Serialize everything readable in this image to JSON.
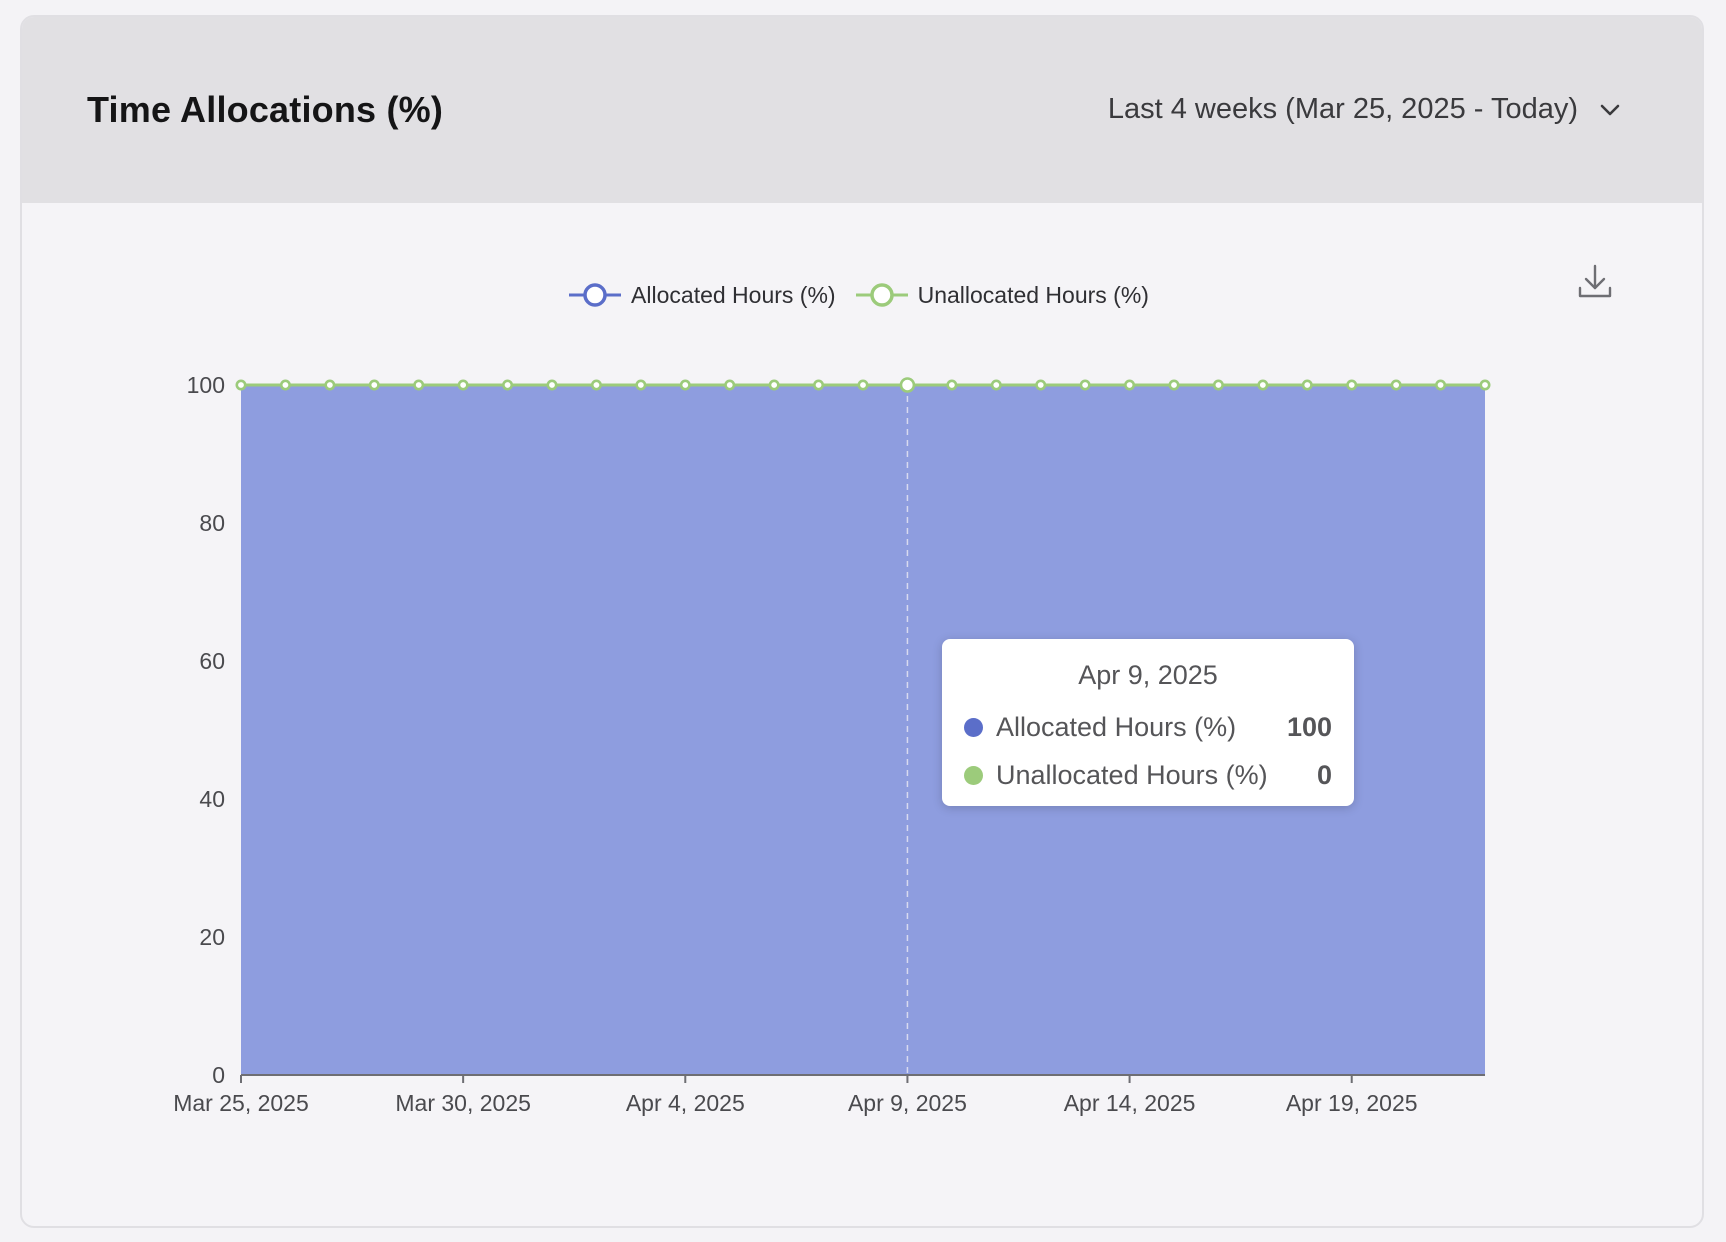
{
  "header": {
    "title": "Time Allocations (%)",
    "range_label": "Last 4 weeks (Mar 25, 2025 - Today)"
  },
  "icons": {
    "range_dropdown": "chevron-down-icon",
    "download": "download-icon"
  },
  "colors": {
    "allocated": "#5b6ec9",
    "allocated_area": "#8e9ddf",
    "unallocated": "#9ccb7b",
    "grid": "#9da9e0",
    "axis": "#6e6e73",
    "tick_text": "#4a4a4e"
  },
  "tooltip": {
    "date": "Apr 9, 2025",
    "rows": [
      {
        "name": "Allocated Hours (%)",
        "value": "100"
      },
      {
        "name": "Unallocated Hours (%)",
        "value": "0"
      }
    ]
  },
  "chart_data": {
    "type": "area",
    "title": "Time Allocations (%)",
    "xlabel": "",
    "ylabel": "",
    "ylim": [
      0,
      100
    ],
    "yticks": [
      "0",
      "20",
      "40",
      "60",
      "80",
      "100"
    ],
    "xticks": [
      "Mar 25, 2025",
      "Mar 30, 2025",
      "Apr 4, 2025",
      "Apr 9, 2025",
      "Apr 14, 2025",
      "Apr 19, 2025"
    ],
    "x": [
      "2025-03-25",
      "2025-03-26",
      "2025-03-27",
      "2025-03-28",
      "2025-03-29",
      "2025-03-30",
      "2025-03-31",
      "2025-04-01",
      "2025-04-02",
      "2025-04-03",
      "2025-04-04",
      "2025-04-05",
      "2025-04-06",
      "2025-04-07",
      "2025-04-08",
      "2025-04-09",
      "2025-04-10",
      "2025-04-11",
      "2025-04-12",
      "2025-04-13",
      "2025-04-14",
      "2025-04-15",
      "2025-04-16",
      "2025-04-17",
      "2025-04-18",
      "2025-04-19",
      "2025-04-20",
      "2025-04-21",
      "2025-04-22"
    ],
    "series": [
      {
        "name": "Allocated Hours (%)",
        "values": [
          100,
          100,
          100,
          100,
          100,
          100,
          100,
          100,
          100,
          100,
          100,
          100,
          100,
          100,
          100,
          100,
          100,
          100,
          100,
          100,
          100,
          100,
          100,
          100,
          100,
          100,
          100,
          100,
          100
        ]
      },
      {
        "name": "Unallocated Hours (%)",
        "stacked_on": "Allocated Hours (%)",
        "values": [
          0,
          0,
          0,
          0,
          0,
          0,
          0,
          0,
          0,
          0,
          0,
          0,
          0,
          0,
          0,
          0,
          0,
          0,
          0,
          0,
          0,
          0,
          0,
          0,
          0,
          0,
          0,
          0,
          0
        ]
      }
    ],
    "highlighted_x": "2025-04-09",
    "legend_position": "top-center",
    "grid": true
  }
}
